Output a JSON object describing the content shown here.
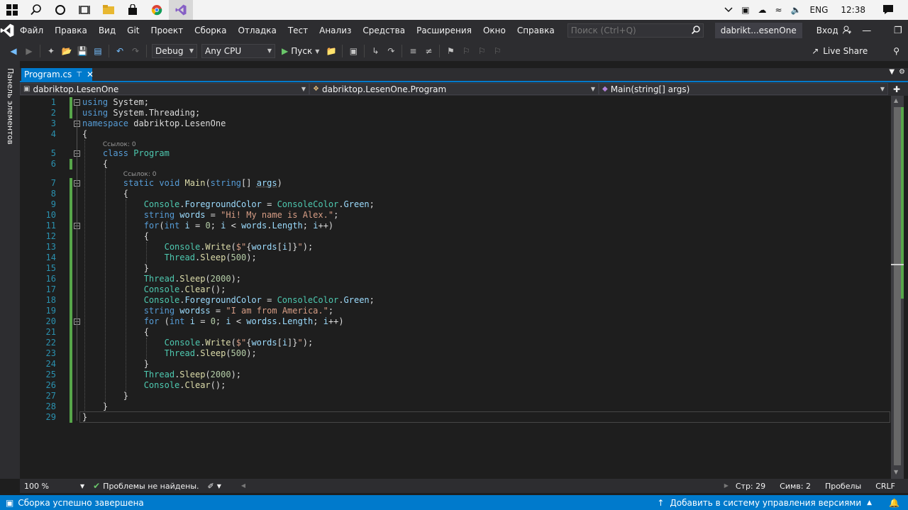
{
  "taskbar": {
    "icons": [
      "windows-start-icon",
      "search-icon",
      "cortana-icon",
      "task-view-icon",
      "file-explorer-icon",
      "store-icon",
      "chrome-icon",
      "visual-studio-icon"
    ],
    "language": "ENG",
    "time": "12:38"
  },
  "menu": {
    "items": [
      "Файл",
      "Правка",
      "Вид",
      "Git",
      "Проект",
      "Сборка",
      "Отладка",
      "Тест",
      "Анализ",
      "Средства",
      "Расширения",
      "Окно",
      "Справка"
    ],
    "search_placeholder": "Поиск (Ctrl+Q)",
    "solution_name": "dabrikt...esenOne",
    "sign_in": "Вход"
  },
  "toolbar": {
    "configuration": "Debug",
    "platform": "Any CPU",
    "run_label": "Пуск",
    "live_share": "Live Share"
  },
  "toolbox": {
    "label": "Панель элементов"
  },
  "tabs": [
    {
      "label": "Program.cs",
      "active": true
    }
  ],
  "navbar": {
    "project": "dabriktop.LesenOne",
    "type": "dabriktop.LesenOne.Program",
    "member": "Main(string[] args)"
  },
  "editor": {
    "code_lens_1": "Ссылок: 0",
    "code_lens_2": "Ссылок: 0",
    "line_numbers": [
      "1",
      "2",
      "3",
      "4",
      "5",
      "6",
      "7",
      "8",
      "9",
      "10",
      "11",
      "12",
      "13",
      "14",
      "15",
      "16",
      "17",
      "18",
      "19",
      "20",
      "21",
      "22",
      "23",
      "24",
      "25",
      "26",
      "27",
      "28",
      "29"
    ],
    "lines": [
      [
        [
          "kw",
          "using"
        ],
        [
          "pl",
          " System;"
        ]
      ],
      [
        [
          "kw",
          "using"
        ],
        [
          "pl",
          " System.Threading;"
        ]
      ],
      [
        [
          "kw",
          "namespace"
        ],
        [
          "pl",
          " dabriktop.LesenOne"
        ]
      ],
      [
        [
          "pl",
          "{"
        ]
      ],
      [
        [
          "pl",
          "    "
        ],
        [
          "kw",
          "class"
        ],
        [
          "pl",
          " "
        ],
        [
          "ty",
          "Program"
        ]
      ],
      [
        [
          "pl",
          "    {"
        ]
      ],
      [
        [
          "pl",
          "        "
        ],
        [
          "kw",
          "static"
        ],
        [
          "pl",
          " "
        ],
        [
          "kw",
          "void"
        ],
        [
          "pl",
          " "
        ],
        [
          "fn",
          "Main"
        ],
        [
          "pl",
          "("
        ],
        [
          "kw",
          "string"
        ],
        [
          "pl",
          "[] "
        ],
        [
          "pm",
          "args"
        ],
        [
          "pl",
          ")"
        ]
      ],
      [
        [
          "pl",
          "        {"
        ]
      ],
      [
        [
          "pl",
          "            "
        ],
        [
          "ty",
          "Console"
        ],
        [
          "pl",
          "."
        ],
        [
          "id",
          "ForegroundColor"
        ],
        [
          "pl",
          " = "
        ],
        [
          "ty",
          "ConsoleColor"
        ],
        [
          "pl",
          "."
        ],
        [
          "id",
          "Green"
        ],
        [
          "pl",
          ";"
        ]
      ],
      [
        [
          "pl",
          "            "
        ],
        [
          "kw",
          "string"
        ],
        [
          "pl",
          " "
        ],
        [
          "id",
          "words"
        ],
        [
          "pl",
          " = "
        ],
        [
          "st",
          "\"Hi! My name is Alex.\""
        ],
        [
          "pl",
          ";"
        ]
      ],
      [
        [
          "pl",
          "            "
        ],
        [
          "kw",
          "for"
        ],
        [
          "pl",
          "("
        ],
        [
          "kw",
          "int"
        ],
        [
          "pl",
          " "
        ],
        [
          "id",
          "i"
        ],
        [
          "pl",
          " = "
        ],
        [
          "nm",
          "0"
        ],
        [
          "pl",
          "; "
        ],
        [
          "id",
          "i"
        ],
        [
          "pl",
          " < "
        ],
        [
          "id",
          "words"
        ],
        [
          "pl",
          "."
        ],
        [
          "id",
          "Length"
        ],
        [
          "pl",
          "; "
        ],
        [
          "id",
          "i"
        ],
        [
          "pl",
          "++)"
        ]
      ],
      [
        [
          "pl",
          "            {"
        ]
      ],
      [
        [
          "pl",
          "                "
        ],
        [
          "ty",
          "Console"
        ],
        [
          "pl",
          "."
        ],
        [
          "fn",
          "Write"
        ],
        [
          "pl",
          "("
        ],
        [
          "st",
          "$\""
        ],
        [
          "pl",
          "{"
        ],
        [
          "id",
          "words"
        ],
        [
          "pl",
          "["
        ],
        [
          "id",
          "i"
        ],
        [
          "pl",
          "]}"
        ],
        [
          "st",
          "\""
        ],
        [
          "pl",
          ");"
        ]
      ],
      [
        [
          "pl",
          "                "
        ],
        [
          "ty",
          "Thread"
        ],
        [
          "pl",
          "."
        ],
        [
          "fn",
          "Sleep"
        ],
        [
          "pl",
          "("
        ],
        [
          "nm",
          "500"
        ],
        [
          "pl",
          ");"
        ]
      ],
      [
        [
          "pl",
          "            }"
        ]
      ],
      [
        [
          "pl",
          "            "
        ],
        [
          "ty",
          "Thread"
        ],
        [
          "pl",
          "."
        ],
        [
          "fn",
          "Sleep"
        ],
        [
          "pl",
          "("
        ],
        [
          "nm",
          "2000"
        ],
        [
          "pl",
          ");"
        ]
      ],
      [
        [
          "pl",
          "            "
        ],
        [
          "ty",
          "Console"
        ],
        [
          "pl",
          "."
        ],
        [
          "fn",
          "Clear"
        ],
        [
          "pl",
          "();"
        ]
      ],
      [
        [
          "pl",
          "            "
        ],
        [
          "ty",
          "Console"
        ],
        [
          "pl",
          "."
        ],
        [
          "id",
          "ForegroundColor"
        ],
        [
          "pl",
          " = "
        ],
        [
          "ty",
          "ConsoleColor"
        ],
        [
          "pl",
          "."
        ],
        [
          "id",
          "Green"
        ],
        [
          "pl",
          ";"
        ]
      ],
      [
        [
          "pl",
          "            "
        ],
        [
          "kw",
          "string"
        ],
        [
          "pl",
          " "
        ],
        [
          "id",
          "wordss"
        ],
        [
          "pl",
          " = "
        ],
        [
          "st",
          "\"I am from America.\""
        ],
        [
          "pl",
          ";"
        ]
      ],
      [
        [
          "pl",
          "            "
        ],
        [
          "kw",
          "for"
        ],
        [
          "pl",
          " ("
        ],
        [
          "kw",
          "int"
        ],
        [
          "pl",
          " "
        ],
        [
          "id",
          "i"
        ],
        [
          "pl",
          " = "
        ],
        [
          "nm",
          "0"
        ],
        [
          "pl",
          "; "
        ],
        [
          "id",
          "i"
        ],
        [
          "pl",
          " < "
        ],
        [
          "id",
          "wordss"
        ],
        [
          "pl",
          "."
        ],
        [
          "id",
          "Length"
        ],
        [
          "pl",
          "; "
        ],
        [
          "id",
          "i"
        ],
        [
          "pl",
          "++)"
        ]
      ],
      [
        [
          "pl",
          "            {"
        ]
      ],
      [
        [
          "pl",
          "                "
        ],
        [
          "ty",
          "Console"
        ],
        [
          "pl",
          "."
        ],
        [
          "fn",
          "Write"
        ],
        [
          "pl",
          "("
        ],
        [
          "st",
          "$\""
        ],
        [
          "pl",
          "{"
        ],
        [
          "id",
          "words"
        ],
        [
          "pl",
          "["
        ],
        [
          "id",
          "i"
        ],
        [
          "pl",
          "]}"
        ],
        [
          "st",
          "\""
        ],
        [
          "pl",
          ");"
        ]
      ],
      [
        [
          "pl",
          "                "
        ],
        [
          "ty",
          "Thread"
        ],
        [
          "pl",
          "."
        ],
        [
          "fn",
          "Sleep"
        ],
        [
          "pl",
          "("
        ],
        [
          "nm",
          "500"
        ],
        [
          "pl",
          ");"
        ]
      ],
      [
        [
          "pl",
          "            }"
        ]
      ],
      [
        [
          "pl",
          "            "
        ],
        [
          "ty",
          "Thread"
        ],
        [
          "pl",
          "."
        ],
        [
          "fn",
          "Sleep"
        ],
        [
          "pl",
          "("
        ],
        [
          "nm",
          "2000"
        ],
        [
          "pl",
          ");"
        ]
      ],
      [
        [
          "pl",
          "            "
        ],
        [
          "ty",
          "Console"
        ],
        [
          "pl",
          "."
        ],
        [
          "fn",
          "Clear"
        ],
        [
          "pl",
          "();"
        ]
      ],
      [
        [
          "pl",
          "        }"
        ]
      ],
      [
        [
          "pl",
          "    }"
        ]
      ],
      [
        [
          "pl",
          "}"
        ]
      ]
    ]
  },
  "editor_status": {
    "zoom": "100 %",
    "issues": "Проблемы не найдены.",
    "line": "Стр: 29",
    "column": "Симв: 2",
    "whitespace": "Пробелы",
    "line_ending": "CRLF"
  },
  "statusbar": {
    "message": "Сборка успешно завершена",
    "source_control": "Добавить в систему управления версиями"
  },
  "colors": {
    "accent": "#007acc",
    "background": "#1e1e1e",
    "chrome": "#2d2d30",
    "keyword": "#569cd6",
    "type": "#4ec9b0",
    "string": "#d69d85",
    "number": "#b5cea8",
    "method": "#dcdcaa",
    "identifier": "#9cdcfe",
    "line_number": "#2b91af",
    "change_bar": "#57a64a"
  }
}
